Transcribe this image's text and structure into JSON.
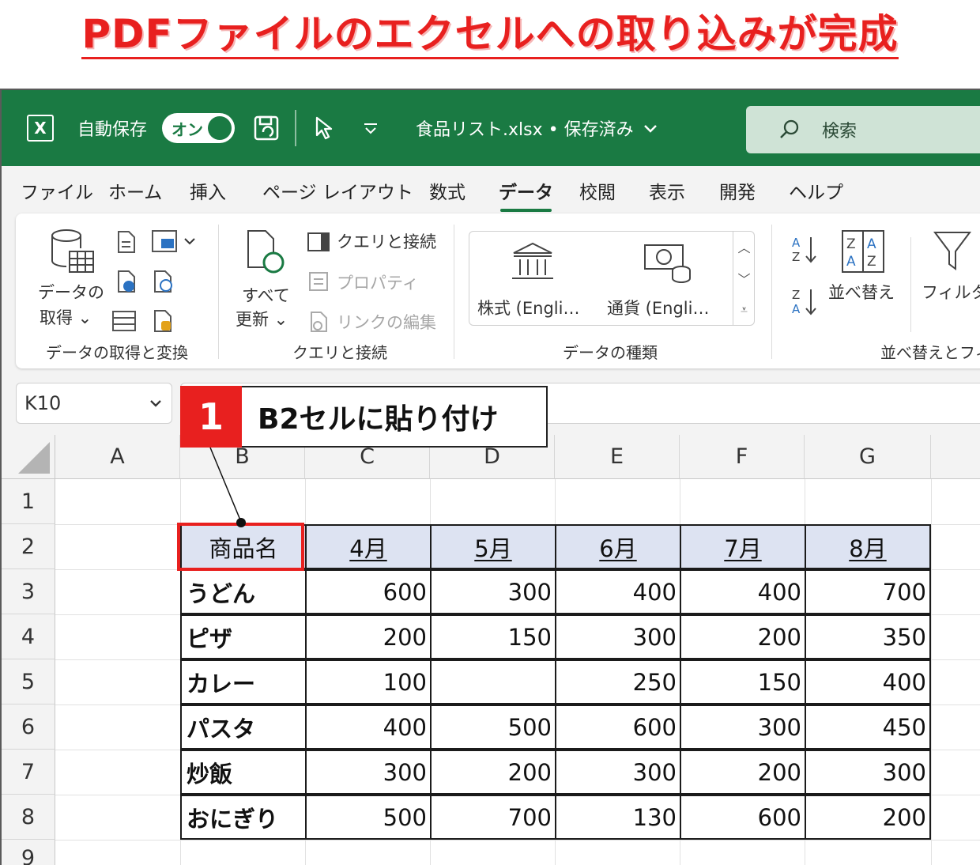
{
  "headline": "PDFファイルのエクセルへの取り込みが完成",
  "titlebar": {
    "logo": "X",
    "autosave_label": "自動保存",
    "toggle_label": "オン",
    "file_title": "食品リスト.xlsx • 保存済み",
    "search_placeholder": "検索",
    "accent": "#1a7a43"
  },
  "tabs": [
    "ファイル",
    "ホーム",
    "挿入",
    "ページ レイアウト",
    "数式",
    "データ",
    "校閲",
    "表示",
    "開発",
    "ヘルプ"
  ],
  "active_tab": "データ",
  "ribbon": {
    "get_data": {
      "label1": "データの",
      "label2": "取得 ⌄",
      "group": "データの取得と変換"
    },
    "refresh": {
      "label1": "すべて",
      "label2": "更新 ⌄"
    },
    "queries": {
      "item1": "クエリと接続",
      "item2": "プロパティ",
      "item3": "リンクの編集",
      "group": "クエリと接続"
    },
    "datatypes": {
      "stocks": "株式 (Engli…",
      "currency": "通貨 (Engli…",
      "group": "データの種類"
    },
    "sort": {
      "label": "並べ替え",
      "filter": "フィルター",
      "group": "並べ替えとフィ"
    }
  },
  "namebox": {
    "value": "K10"
  },
  "columns": [
    "A",
    "B",
    "C",
    "D",
    "E",
    "F",
    "G"
  ],
  "rows": [
    "1",
    "2",
    "3",
    "4",
    "5",
    "6",
    "7",
    "8",
    "9"
  ],
  "table": {
    "header": [
      "商品名",
      "4月",
      "5月",
      "6月",
      "7月",
      "8月"
    ],
    "body": [
      [
        "うどん",
        "600",
        "300",
        "400",
        "400",
        "700"
      ],
      [
        "ピザ",
        "200",
        "150",
        "300",
        "200",
        "350"
      ],
      [
        "カレー",
        "100",
        "",
        "250",
        "150",
        "400"
      ],
      [
        "パスタ",
        "400",
        "500",
        "600",
        "300",
        "450"
      ],
      [
        "炒飯",
        "300",
        "200",
        "300",
        "200",
        "300"
      ],
      [
        "おにぎり",
        "500",
        "700",
        "130",
        "600",
        "200"
      ]
    ]
  },
  "callout": {
    "number": "1",
    "text": "B2セルに貼り付け"
  }
}
